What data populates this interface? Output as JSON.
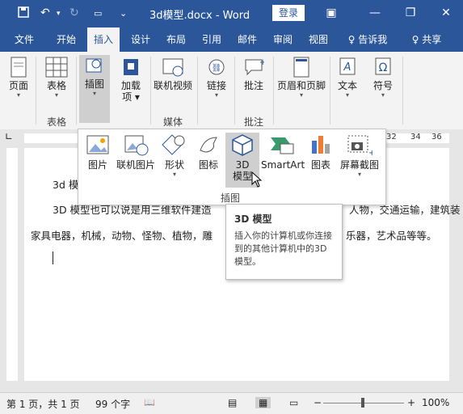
{
  "titlebar": {
    "doc_title": "3d模型.docx - Word",
    "login": "登录",
    "minimize": "—",
    "restore": "❐",
    "close": "✕",
    "ribbon_toggle": "▣"
  },
  "tabs": [
    "文件",
    "开始",
    "插入",
    "设计",
    "布局",
    "引用",
    "邮件",
    "审阅",
    "视图",
    "♀ 告诉我",
    "♀ 共享"
  ],
  "ribbon": {
    "page": "页面",
    "table": "表格",
    "table_group": "表格",
    "illustrations": "插图",
    "addins": "加载项",
    "online_video": "联机视频",
    "media_group": "媒体",
    "link": "链接",
    "comment": "批注",
    "comment_group": "批注",
    "header_footer": "页眉和页脚",
    "text": "文本",
    "symbol": "符号"
  },
  "ruler_numbers": [
    "32",
    "34",
    "36"
  ],
  "panel": {
    "items": [
      "图片",
      "联机图片",
      "形状",
      "图标",
      "3D 模型",
      "SmartArt",
      "图表",
      "屏幕截图"
    ],
    "group": "插图"
  },
  "tooltip": {
    "title": "3D 模型",
    "body": "插入你的计算机或你连接到的其他计算机中的3D 模型。"
  },
  "document": {
    "line1": "3d 模",
    "line2": "3D 模型也可以说是用三维软件建造",
    "line2_right": "人物，交通运输，建筑装",
    "line3": "家具电器，机械，动物、怪物、植物，雕",
    "line3_right": "乐器，艺术品等等。"
  },
  "status": {
    "page": "第 1 页，共 1 页",
    "words": "99 个字",
    "zoom": "100%",
    "minus": "−",
    "plus": "+"
  }
}
